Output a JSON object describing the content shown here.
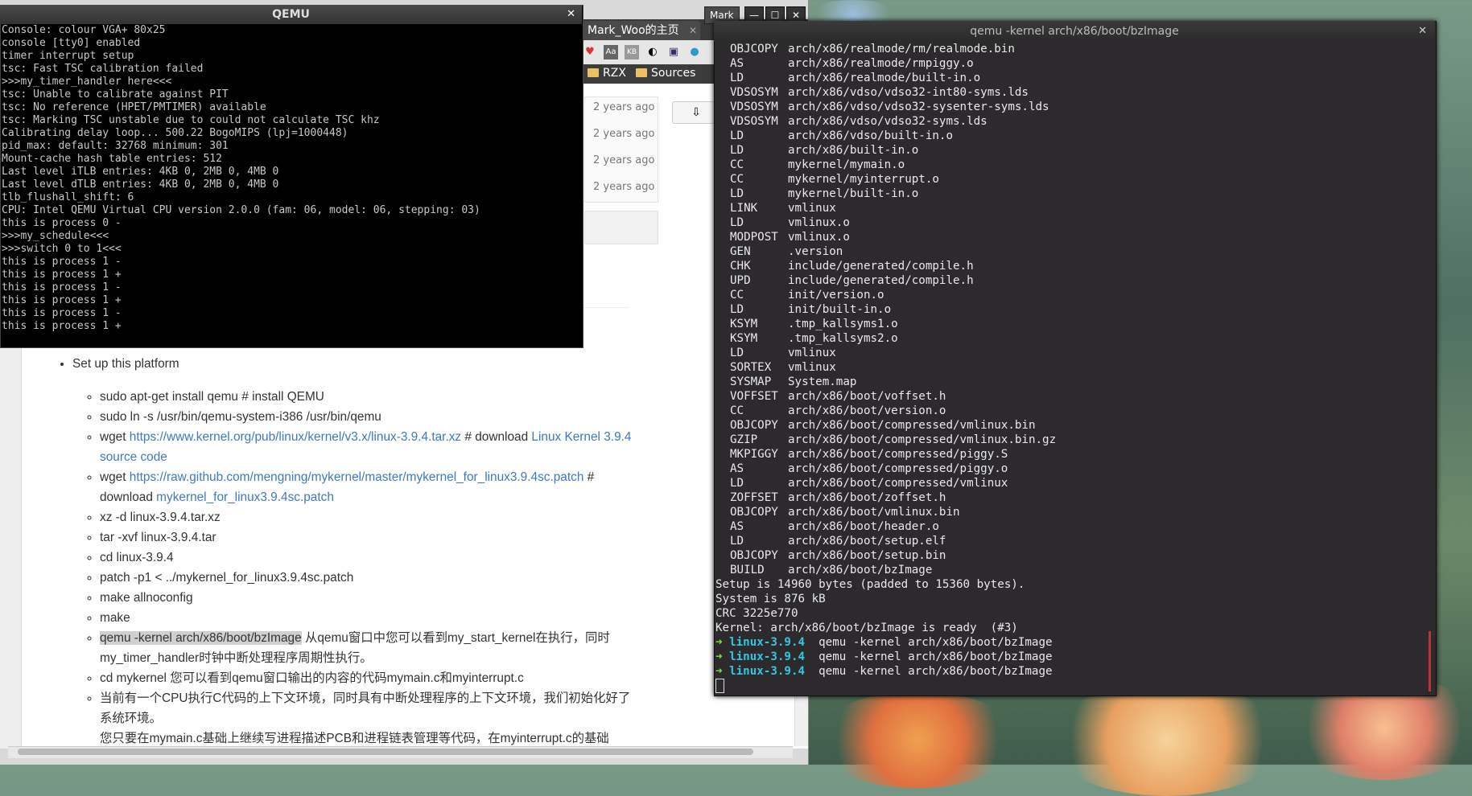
{
  "browser": {
    "tab_title": "Mark_Woo的主页",
    "wm_user": "Mark",
    "bookmarks": [
      "RZX",
      "Sources"
    ],
    "commit_ages": [
      "2 years ago",
      "2 years ago",
      "2 years ago",
      "2 years ago"
    ],
    "content": {
      "setup_heading": "Set up this platform",
      "steps": [
        {
          "pre": "sudo apt-get install qemu # install QEMU"
        },
        {
          "pre": "sudo ln -s /usr/bin/qemu-system-i386 /usr/bin/qemu"
        },
        {
          "pre": "wget ",
          "link": "https://www.kernel.org/pub/linux/kernel/v3.x/linux-3.9.4.tar.xz",
          "mid": " # download ",
          "link2": "Linux Kernel 3.9.4 source code"
        },
        {
          "pre": "wget ",
          "link": "https://raw.github.com/mengning/mykernel/master/mykernel_for_linux3.9.4sc.patch",
          "mid": " # download ",
          "link2": "mykernel_for_linux3.9.4sc.patch"
        },
        {
          "pre": "xz -d linux-3.9.4.tar.xz"
        },
        {
          "pre": "tar -xvf linux-3.9.4.tar"
        },
        {
          "pre": "cd linux-3.9.4"
        },
        {
          "pre": "patch -p1 < ../mykernel_for_linux3.9.4sc.patch"
        },
        {
          "pre": "make allnoconfig"
        },
        {
          "pre": "make"
        },
        {
          "hl": "qemu -kernel arch/x86/boot/bzImage",
          "post": " 从qemu窗口中您可以看到my_start_kernel在执行，同时my_timer_handler时钟中断处理程序周期性执行。"
        },
        {
          "pre": "cd mykernel 您可以看到qemu窗口输出的内容的代码mymain.c和myinterrupt.c"
        },
        {
          "pre": "当前有一个CPU执行C代码的上下文环境，同时具有中断处理程序的上下文环境，我们初始化好了系统环境。"
        },
        {
          "pre": "您只要在mymain.c基础上继续写进程描述PCB和进程链表管理等代码，在myinterrupt.c的基础"
        }
      ]
    }
  },
  "qemu": {
    "title": "QEMU",
    "lines": [
      "Console: colour VGA+ 80x25",
      "console [tty0] enabled",
      "timer interrupt setup",
      "tsc: Fast TSC calibration failed",
      ">>>my_timer_handler here<<<",
      "tsc: Unable to calibrate against PIT",
      "tsc: No reference (HPET/PMTIMER) available",
      "tsc: Marking TSC unstable due to could not calculate TSC khz",
      "Calibrating delay loop... 500.22 BogoMIPS (lpj=1000448)",
      "pid_max: default: 32768 minimum: 301",
      "Mount-cache hash table entries: 512",
      "Last level iTLB entries: 4KB 0, 2MB 0, 4MB 0",
      "Last level dTLB entries: 4KB 0, 2MB 0, 4MB 0",
      "tlb_flushall_shift: 6",
      "CPU: Intel QEMU Virtual CPU version 2.0.0 (fam: 06, model: 06, stepping: 03)",
      "this is process 0 -",
      ">>>my_schedule<<<",
      ">>>switch 0 to 1<<<",
      "this is process 1 -",
      "this is process 1 +",
      "this is process 1 -",
      "this is process 1 +",
      "this is process 1 -",
      "this is process 1 +"
    ]
  },
  "terminal": {
    "title": "qemu -kernel arch/x86/boot/bzImage",
    "build_lines": [
      {
        "tag": "OBJCOPY",
        "path": "arch/x86/realmode/rm/realmode.bin"
      },
      {
        "tag": "AS",
        "path": "arch/x86/realmode/rmpiggy.o"
      },
      {
        "tag": "LD",
        "path": "arch/x86/realmode/built-in.o"
      },
      {
        "tag": "VDSOSYM",
        "path": "arch/x86/vdso/vdso32-int80-syms.lds"
      },
      {
        "tag": "VDSOSYM",
        "path": "arch/x86/vdso/vdso32-sysenter-syms.lds"
      },
      {
        "tag": "VDSOSYM",
        "path": "arch/x86/vdso/vdso32-syms.lds"
      },
      {
        "tag": "LD",
        "path": "arch/x86/vdso/built-in.o"
      },
      {
        "tag": "LD",
        "path": "arch/x86/built-in.o"
      },
      {
        "tag": "CC",
        "path": "mykernel/mymain.o"
      },
      {
        "tag": "CC",
        "path": "mykernel/myinterrupt.o"
      },
      {
        "tag": "LD",
        "path": "mykernel/built-in.o"
      },
      {
        "tag": "LINK",
        "path": "vmlinux"
      },
      {
        "tag": "LD",
        "path": "vmlinux.o"
      },
      {
        "tag": "MODPOST",
        "path": "vmlinux.o"
      },
      {
        "tag": "GEN",
        "path": ".version"
      },
      {
        "tag": "CHK",
        "path": "include/generated/compile.h"
      },
      {
        "tag": "UPD",
        "path": "include/generated/compile.h"
      },
      {
        "tag": "CC",
        "path": "init/version.o"
      },
      {
        "tag": "LD",
        "path": "init/built-in.o"
      },
      {
        "tag": "KSYM",
        "path": ".tmp_kallsyms1.o"
      },
      {
        "tag": "KSYM",
        "path": ".tmp_kallsyms2.o"
      },
      {
        "tag": "LD",
        "path": "vmlinux"
      },
      {
        "tag": "SORTEX",
        "path": "vmlinux"
      },
      {
        "tag": "SYSMAP",
        "path": "System.map"
      },
      {
        "tag": "VOFFSET",
        "path": "arch/x86/boot/voffset.h"
      },
      {
        "tag": "CC",
        "path": "arch/x86/boot/version.o"
      },
      {
        "tag": "OBJCOPY",
        "path": "arch/x86/boot/compressed/vmlinux.bin"
      },
      {
        "tag": "GZIP",
        "path": "arch/x86/boot/compressed/vmlinux.bin.gz"
      },
      {
        "tag": "MKPIGGY",
        "path": "arch/x86/boot/compressed/piggy.S"
      },
      {
        "tag": "AS",
        "path": "arch/x86/boot/compressed/piggy.o"
      },
      {
        "tag": "LD",
        "path": "arch/x86/boot/compressed/vmlinux"
      },
      {
        "tag": "ZOFFSET",
        "path": "arch/x86/boot/zoffset.h"
      },
      {
        "tag": "OBJCOPY",
        "path": "arch/x86/boot/vmlinux.bin"
      },
      {
        "tag": "AS",
        "path": "arch/x86/boot/header.o"
      },
      {
        "tag": "LD",
        "path": "arch/x86/boot/setup.elf"
      },
      {
        "tag": "OBJCOPY",
        "path": "arch/x86/boot/setup.bin"
      },
      {
        "tag": "BUILD",
        "path": "arch/x86/boot/bzImage"
      }
    ],
    "plain_lines": [
      "Setup is 14960 bytes (padded to 15360 bytes).",
      "System is 876 kB",
      "CRC 3225e770",
      "Kernel: arch/x86/boot/bzImage is ready  (#3)"
    ],
    "prompts": [
      {
        "arrow": "➜",
        "dir": "linux-3.9.4",
        "cmd": "qemu -kernel arch/x86/boot/bzImage"
      },
      {
        "arrow": "➜",
        "dir": "linux-3.9.4",
        "cmd": "qemu -kernel arch/x86/boot/bzImage"
      },
      {
        "arrow": "➜",
        "dir": "linux-3.9.4",
        "cmd": "qemu -kernel arch/x86/boot/bzImage"
      }
    ]
  }
}
